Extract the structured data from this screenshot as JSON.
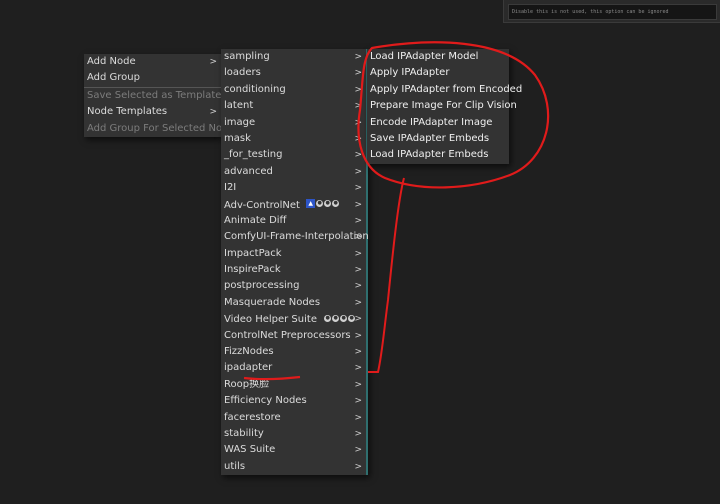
{
  "top_panel": {
    "text": "Disable this is not used, this option can be ignored"
  },
  "menu_main": {
    "items": [
      {
        "label": "Add Node",
        "has_sub": true
      },
      {
        "label": "Add Group",
        "has_sub": false
      },
      {
        "label": "Save Selected as Template",
        "disabled": true,
        "sep": true
      },
      {
        "label": "Node Templates",
        "has_sub": true
      },
      {
        "label": "Add Group For Selected Nodes",
        "disabled": true
      }
    ]
  },
  "menu_categories": {
    "arrow": ">",
    "items": [
      "sampling",
      "loaders",
      "conditioning",
      "latent",
      "image",
      "mask",
      "_for_testing",
      "advanced",
      "I2I",
      "Adv-ControlNet",
      "Animate Diff",
      "ComfyUI-Frame-Interpolation",
      "ImpactPack",
      "InspirePack",
      "postprocessing",
      "Masquerade Nodes",
      "Video Helper Suite",
      "ControlNet Preprocessors",
      "FizzNodes",
      "ipadapter",
      "Roop换脸",
      "Efficiency Nodes",
      "facerestore",
      "stability",
      "WAS Suite",
      "utils"
    ]
  },
  "menu_ipadapter": {
    "items": [
      "Load IPAdapter Model",
      "Apply IPAdapter",
      "Apply IPAdapter from Encoded",
      "Prepare Image For Clip Vision",
      "Encode IPAdapter Image",
      "Save IPAdapter Embeds",
      "Load IPAdapter Embeds"
    ]
  },
  "annotation_color": "#e01b1b",
  "category_border_color": "#2f6f6f"
}
